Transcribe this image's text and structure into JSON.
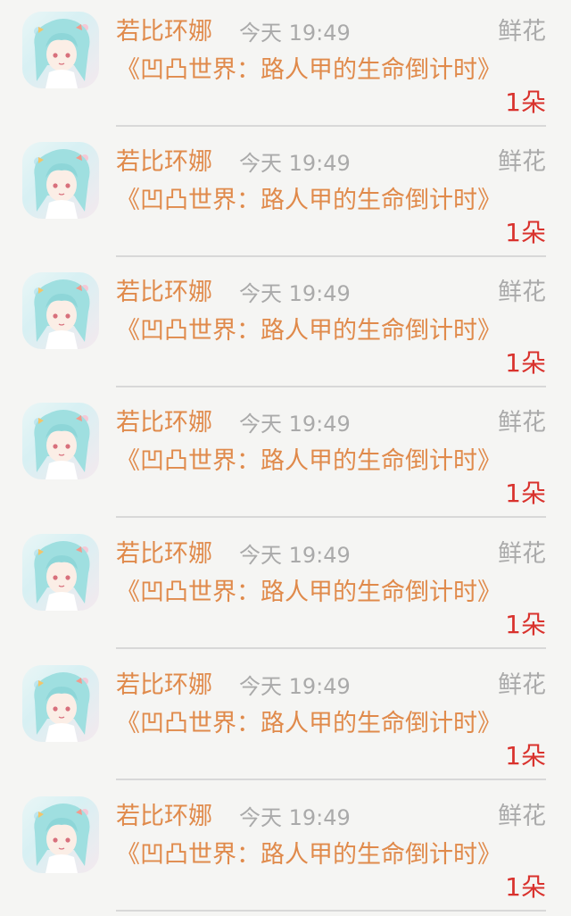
{
  "notifications": [
    {
      "name": "若比环娜",
      "time": "今天 19:49",
      "gift_type": "鲜花",
      "book_title": "《凹凸世界：路人甲的生命倒计时》",
      "count": "1朵"
    },
    {
      "name": "若比环娜",
      "time": "今天 19:49",
      "gift_type": "鲜花",
      "book_title": "《凹凸世界：路人甲的生命倒计时》",
      "count": "1朵"
    },
    {
      "name": "若比环娜",
      "time": "今天 19:49",
      "gift_type": "鲜花",
      "book_title": "《凹凸世界：路人甲的生命倒计时》",
      "count": "1朵"
    },
    {
      "name": "若比环娜",
      "time": "今天 19:49",
      "gift_type": "鲜花",
      "book_title": "《凹凸世界：路人甲的生命倒计时》",
      "count": "1朵"
    },
    {
      "name": "若比环娜",
      "time": "今天 19:49",
      "gift_type": "鲜花",
      "book_title": "《凹凸世界：路人甲的生命倒计时》",
      "count": "1朵"
    },
    {
      "name": "若比环娜",
      "time": "今天 19:49",
      "gift_type": "鲜花",
      "book_title": "《凹凸世界：路人甲的生命倒计时》",
      "count": "1朵"
    },
    {
      "name": "若比环娜",
      "time": "今天 19:49",
      "gift_type": "鲜花",
      "book_title": "《凹凸世界：路人甲的生命倒计时》",
      "count": "1朵"
    }
  ],
  "colors": {
    "background": "#f5f5f3",
    "name": "#e08a4b",
    "book_title": "#e08a4b",
    "meta_gray": "#aaaaaa",
    "count_red": "#d9322d",
    "divider": "#d8d8d8"
  },
  "avatar": {
    "icon": "anime-girl-avatar"
  }
}
